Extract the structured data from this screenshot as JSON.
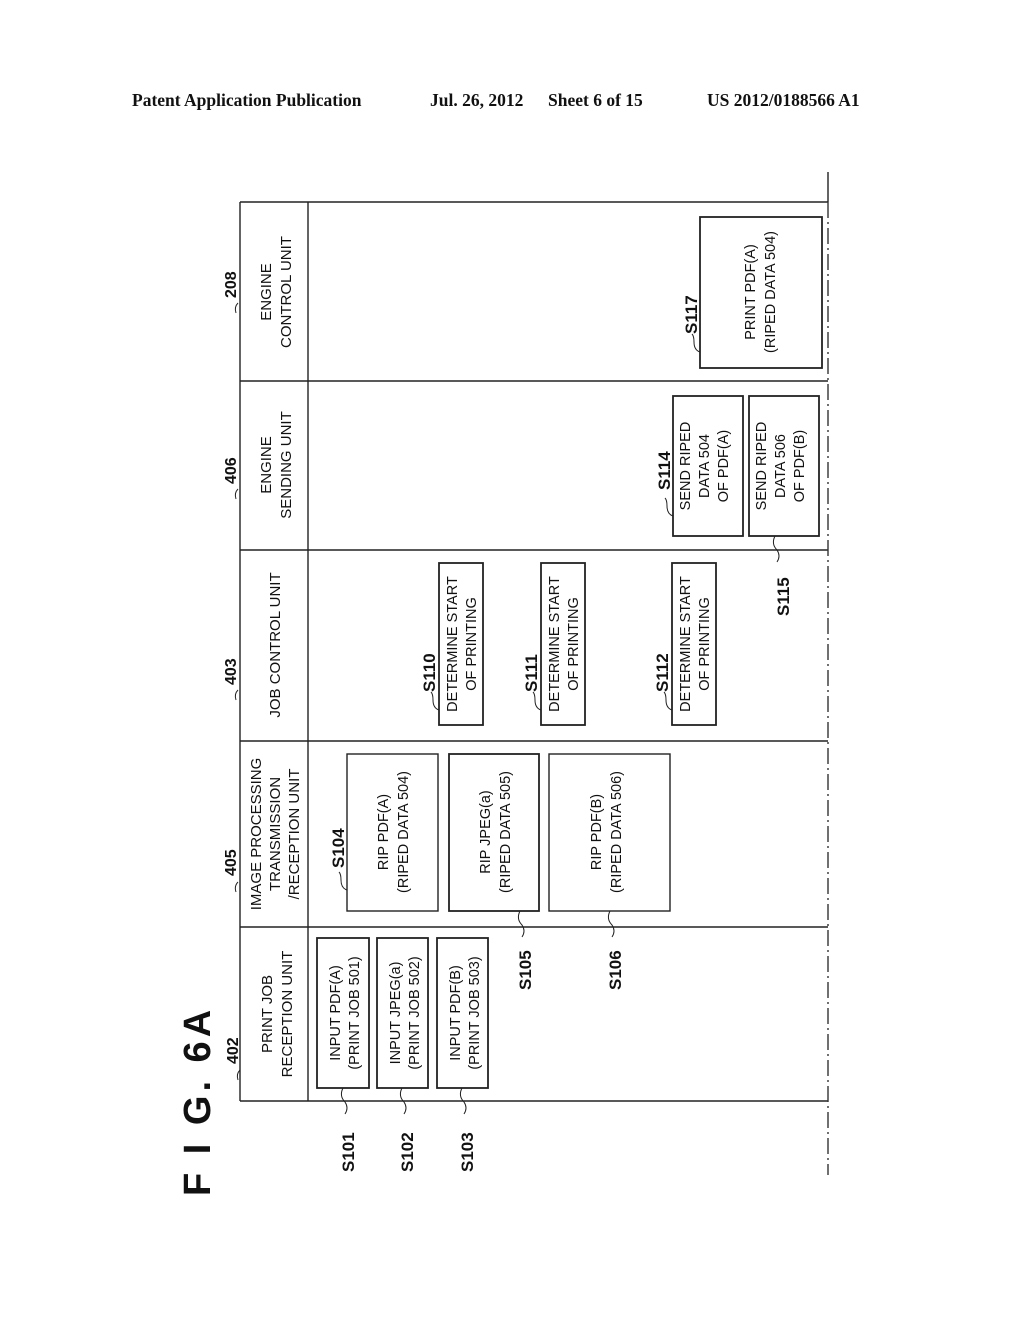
{
  "header": {
    "publication": "Patent Application Publication",
    "date": "Jul. 26, 2012",
    "sheet": "Sheet 6 of 15",
    "number": "US 2012/0188566 A1"
  },
  "figure": {
    "label": "F I G. 6A"
  },
  "lanes": [
    {
      "ref": "402",
      "lines": [
        "PRINT JOB",
        "RECEPTION UNIT"
      ]
    },
    {
      "ref": "405",
      "lines": [
        "IMAGE PROCESSING",
        "TRANSMISSION",
        "/RECEPTION UNIT"
      ]
    },
    {
      "ref": "403",
      "lines": [
        "JOB CONTROL UNIT"
      ]
    },
    {
      "ref": "406",
      "lines": [
        "ENGINE",
        "SENDING UNIT"
      ]
    },
    {
      "ref": "208",
      "lines": [
        "ENGINE",
        "CONTROL UNIT"
      ]
    }
  ],
  "steps": [
    {
      "id": "S101",
      "lane": "402",
      "lines": [
        "INPUT PDF(A)",
        "(PRINT JOB 501)"
      ]
    },
    {
      "id": "S102",
      "lane": "402",
      "lines": [
        "INPUT JPEG(a)",
        "(PRINT JOB 502)"
      ]
    },
    {
      "id": "S103",
      "lane": "402",
      "lines": [
        "INPUT PDF(B)",
        "(PRINT JOB 503)"
      ]
    },
    {
      "id": "S104",
      "lane": "405",
      "lines": [
        "RIP PDF(A)",
        "(RIPED DATA 504)"
      ]
    },
    {
      "id": "S105",
      "lane": "405",
      "lines": [
        "RIP JPEG(a)",
        "(RIPED DATA 505)"
      ]
    },
    {
      "id": "S106",
      "lane": "405",
      "lines": [
        "RIP PDF(B)",
        "(RIPED DATA 506)"
      ]
    },
    {
      "id": "S110",
      "lane": "403",
      "lines": [
        "DETERMINE START",
        "OF PRINTING"
      ]
    },
    {
      "id": "S111",
      "lane": "403",
      "lines": [
        "DETERMINE START",
        "OF PRINTING"
      ]
    },
    {
      "id": "S112",
      "lane": "403",
      "lines": [
        "DETERMINE START",
        "OF PRINTING"
      ]
    },
    {
      "id": "S114",
      "lane": "406",
      "lines": [
        "SEND RIPED",
        "DATA 504",
        "OF PDF(A)"
      ]
    },
    {
      "id": "S115",
      "lane": "406",
      "lines": [
        "SEND RIPED",
        "DATA 506",
        "OF PDF(B)"
      ]
    },
    {
      "id": "S117",
      "lane": "208",
      "lines": [
        "PRINT PDF(A)",
        "(RIPED DATA 504)"
      ]
    }
  ]
}
